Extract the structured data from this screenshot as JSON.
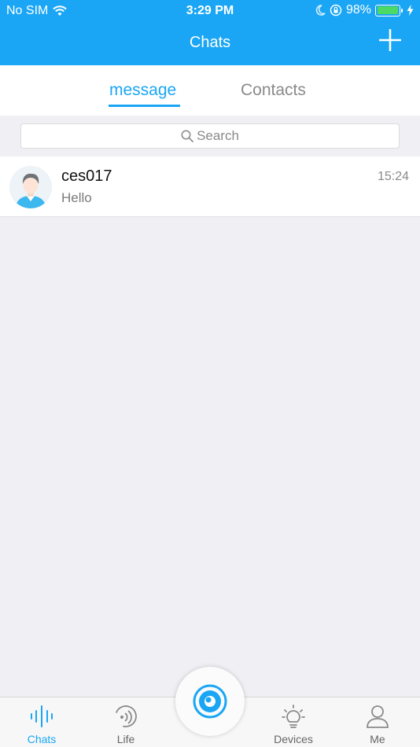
{
  "status_bar": {
    "carrier": "No SIM",
    "time": "3:29 PM",
    "battery_percent": "98%",
    "battery_level": 0.98
  },
  "header": {
    "title": "Chats",
    "add_icon": "plus-icon"
  },
  "tabs": {
    "message": "message",
    "contacts": "Contacts",
    "active": "message"
  },
  "search": {
    "placeholder": "Search",
    "icon": "search-icon"
  },
  "chats": [
    {
      "name": "ces017",
      "preview": "Hello",
      "time": "15:24",
      "avatar": "user-avatar"
    }
  ],
  "tabbar": {
    "items": [
      {
        "label": "Chats",
        "icon": "sound-wave-icon",
        "active": true
      },
      {
        "label": "Life",
        "icon": "broadcast-icon"
      },
      {
        "label": "Devices",
        "icon": "lightbulb-icon"
      },
      {
        "label": "Me",
        "icon": "person-icon"
      }
    ],
    "center_icon": "eye-camera-icon"
  },
  "colors": {
    "brand_blue": "#1aa6f5",
    "background": "#efeff4",
    "battery_green": "#4cd964"
  }
}
